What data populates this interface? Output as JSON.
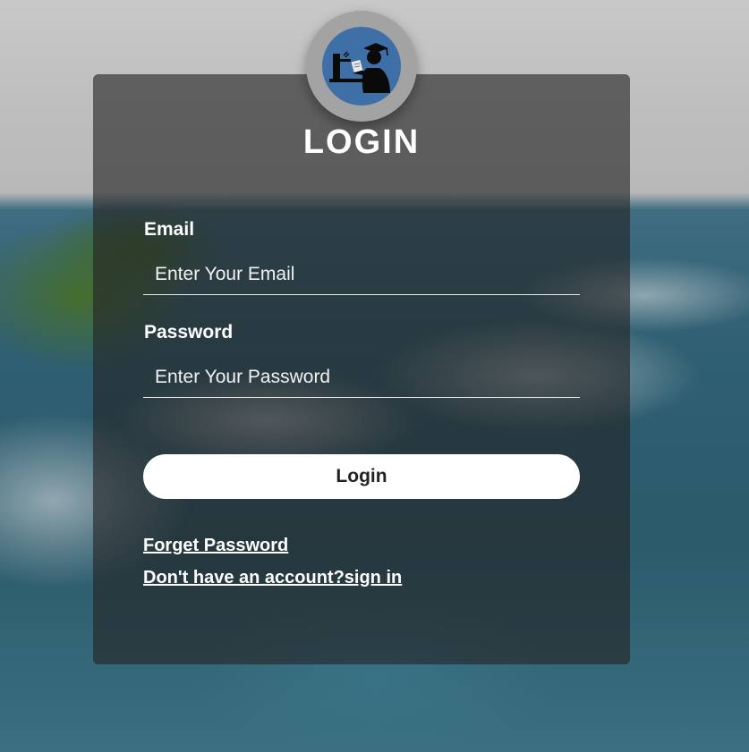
{
  "form": {
    "title": "LOGIN",
    "email_label": "Email",
    "email_placeholder": "Enter Your Email",
    "email_value": "",
    "password_label": "Password",
    "password_placeholder": "Enter Your Password",
    "password_value": "",
    "login_button": "Login",
    "forget_password_link": "Forget Password",
    "signup_link": "Don't have an account?sign in"
  },
  "logo": {
    "icon": "graduate-at-computer-icon",
    "color": "#3e6fa6"
  },
  "colors": {
    "card": "#232323",
    "button": "#ffffff",
    "text": "#ffffff"
  }
}
